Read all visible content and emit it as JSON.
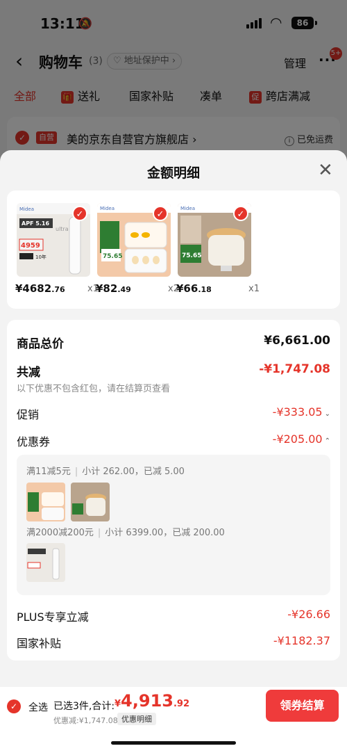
{
  "status_bar": {
    "time": "13:11",
    "battery": "86"
  },
  "nav": {
    "title": "购物车",
    "count": "(3)",
    "address_protect": "♡ 地址保护中 ›",
    "manage": "管理",
    "more": "···",
    "more_badge": "5+"
  },
  "tabs": [
    {
      "label": "全部",
      "active": true
    },
    {
      "label": "送礼",
      "icon": "gift-icon"
    },
    {
      "label": "国家补贴"
    },
    {
      "label": "凑单"
    },
    {
      "label": "跨店满减",
      "icon_text": "促"
    }
  ],
  "shop": {
    "tag": "自营",
    "name": "美的京东自营官方旗舰店 ›",
    "shipping": "已免运费"
  },
  "sheet": {
    "title": "金额明细",
    "products": [
      {
        "price_int": "¥4682",
        "price_dec": ".76",
        "qty": "x1",
        "image": "air-conditioner",
        "img_labels": [
          "APF 5.16",
          "4959",
          "10年",
          "ultra"
        ]
      },
      {
        "price_int": "¥82",
        "price_dec": ".49",
        "qty": "x2",
        "image": "egg-steamer",
        "img_labels": [
          "75.65"
        ]
      },
      {
        "price_int": "¥66",
        "price_dec": ".18",
        "qty": "x1",
        "image": "electric-pot",
        "img_labels": [
          "75.65"
        ]
      }
    ],
    "total": {
      "label": "商品总价",
      "value": "¥6,661.00"
    },
    "reduce": {
      "label": "共减",
      "value": "-¥1,747.08",
      "note": "以下优惠不包含红包，请在结算页查看"
    },
    "promo": {
      "label": "促销",
      "value": "-¥333.05",
      "caret": "⌄"
    },
    "coupon": {
      "label": "优惠券",
      "value": "-¥205.00",
      "caret": "⌃"
    },
    "coupon_details": [
      {
        "rule": "满11减5元",
        "summary": "小计 262.00，已减 5.00"
      },
      {
        "rule": "满2000减200元",
        "summary": "小计 6399.00，已减 200.00"
      }
    ],
    "plus": {
      "label": "PLUS专享立减",
      "value": "-¥26.66"
    },
    "subsidy": {
      "label": "国家补贴",
      "value": "-¥1182.37"
    }
  },
  "bottom": {
    "select_all": "全选",
    "selected": "已选3件,合计:",
    "currency": "¥",
    "amount_int": "4,913",
    "amount_dec": ".92",
    "saved": "优惠减:¥1,747.08",
    "detail_chip": "优惠明细",
    "pay_label": "领券结算"
  },
  "colors": {
    "accent": "#e5342a",
    "button": "#ef3b3b"
  }
}
